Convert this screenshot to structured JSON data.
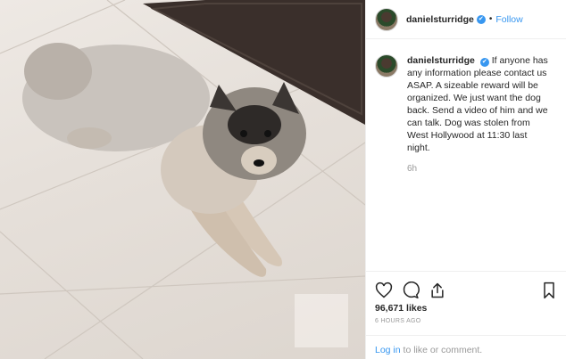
{
  "post": {
    "username": "danielsturridge",
    "verified_badge": "✔",
    "separator": "•",
    "follow_label": "Follow",
    "caption": "If anyone has any information please contact us ASAP. A sizeable reward will be organized. We just want the dog back. Send a video of him and we can talk. Dog was stolen from West Hollywood at 11:30 last night.",
    "comment_time": "6h",
    "likes": "96,671 likes",
    "posted_ago": "6 HOURS AGO",
    "login_link": "Log in",
    "login_suffix": " to like or comment."
  },
  "icons": {
    "like": "heart-icon",
    "comment": "comment-bubble-icon",
    "share": "share-icon",
    "save": "bookmark-icon"
  },
  "colors": {
    "link_blue": "#3897f0",
    "muted_gray": "#999999",
    "text_dark": "#262626",
    "border": "#efefef"
  }
}
